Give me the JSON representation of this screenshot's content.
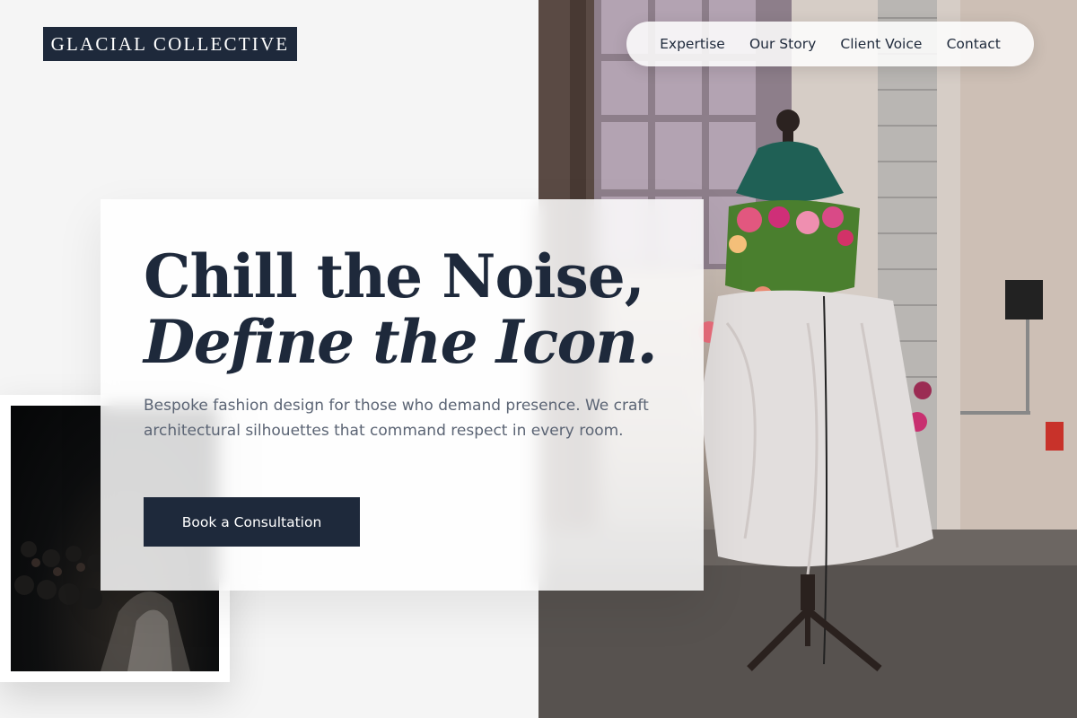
{
  "brand": {
    "name": "Glacial Collective"
  },
  "nav": {
    "items": [
      {
        "label": "Expertise"
      },
      {
        "label": "Our Story"
      },
      {
        "label": "Client Voice"
      },
      {
        "label": "Contact"
      }
    ]
  },
  "hero": {
    "headline_line1": "Chill the Noise,",
    "headline_line2": "Define the Icon.",
    "subtitle": "Bespoke fashion design for those who demand presence. We craft architectural silhouettes that command respect in every room.",
    "cta_label": "Book a Consultation"
  },
  "images": {
    "hero_photo": "mannequin-floral-dress-photo",
    "runway_photo": "dark-runway-audience-photo"
  },
  "colors": {
    "navy": "#1e293b",
    "page_background": "#f5f5f5",
    "card_background": "#ffffff",
    "body_text": "#5b6474"
  }
}
